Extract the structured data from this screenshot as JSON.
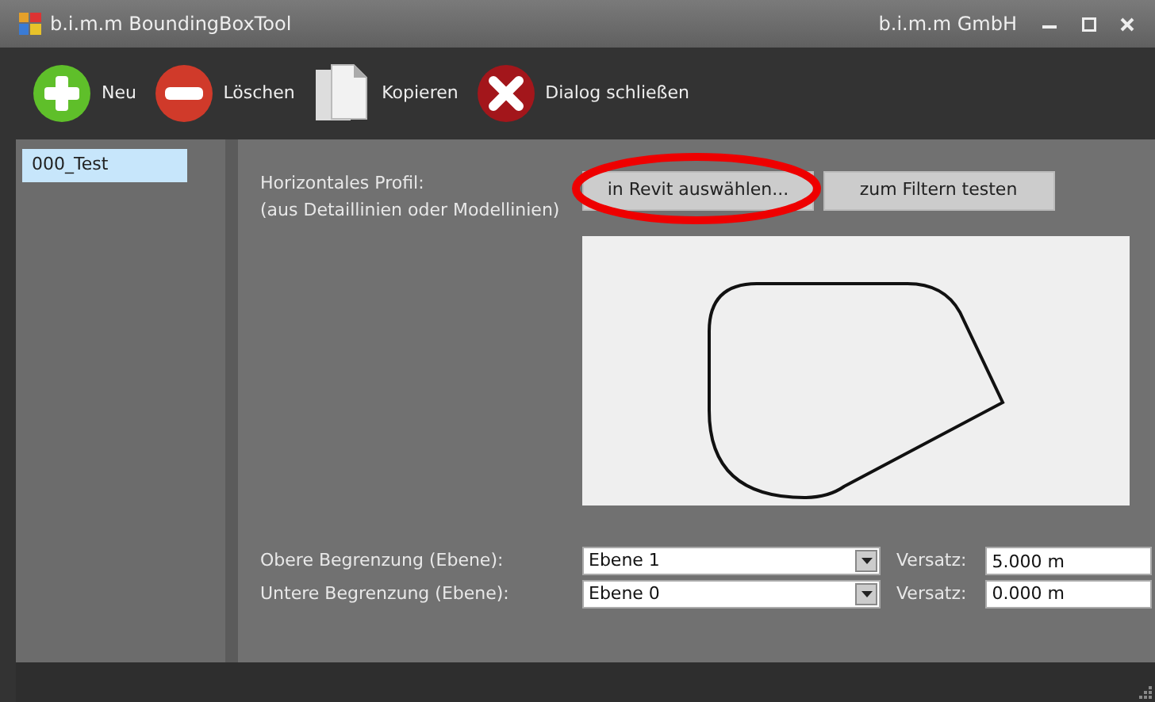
{
  "window": {
    "title": "b.i.m.m BoundingBoxTool",
    "company": "b.i.m.m GmbH"
  },
  "toolbar": [
    {
      "kind": "add",
      "label": "Neu"
    },
    {
      "kind": "delete",
      "label": "Löschen"
    },
    {
      "kind": "copy",
      "label": "Kopieren"
    },
    {
      "kind": "close",
      "label": "Dialog schließen"
    }
  ],
  "sidebar": {
    "items": [
      {
        "label": "000_Test",
        "selected": true
      }
    ]
  },
  "profile": {
    "label": "Horizontales Profil:",
    "hint": "(aus Detaillinien oder Modellinien)",
    "buttons": [
      {
        "label": "in Revit auswählen...",
        "highlighted": true
      },
      {
        "label": "zum Filtern testen",
        "highlighted": false
      }
    ]
  },
  "levels": [
    {
      "label": "Obere Begrenzung (Ebene):",
      "value": "Ebene 1",
      "offset_label": "Versatz:",
      "offset": "5.000 m"
    },
    {
      "label": "Untere Begrenzung (Ebene):",
      "value": "Ebene 0",
      "offset_label": "Versatz:",
      "offset": "0.000 m"
    }
  ]
}
